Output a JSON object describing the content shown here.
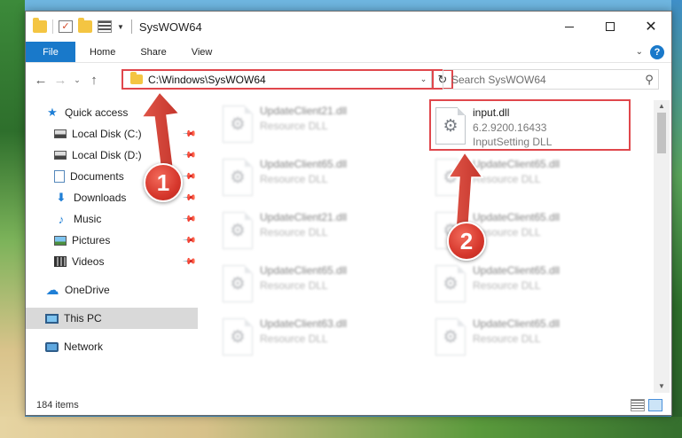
{
  "window": {
    "title": "SysWOW64"
  },
  "ribbon": {
    "tabs": [
      "File",
      "Home",
      "Share",
      "View"
    ],
    "help_label": "?"
  },
  "navigation": {
    "address_path": "C:\\Windows\\SysWOW64",
    "search_placeholder": "Search SysWOW64"
  },
  "sidebar": {
    "items": [
      {
        "label": "Quick access",
        "icon": "star-icon"
      },
      {
        "label": "Local Disk (C:)",
        "icon": "drive-icon",
        "pinned": true
      },
      {
        "label": "Local Disk (D:)",
        "icon": "drive-icon",
        "pinned": true
      },
      {
        "label": "Documents",
        "icon": "documents-icon",
        "pinned": true
      },
      {
        "label": "Downloads",
        "icon": "download-icon",
        "pinned": true
      },
      {
        "label": "Music",
        "icon": "music-icon",
        "pinned": true
      },
      {
        "label": "Pictures",
        "icon": "pictures-icon",
        "pinned": true
      },
      {
        "label": "Videos",
        "icon": "videos-icon",
        "pinned": true
      },
      {
        "label": "OneDrive",
        "icon": "cloud-icon"
      },
      {
        "label": "This PC",
        "icon": "computer-icon",
        "selected": true
      },
      {
        "label": "Network",
        "icon": "network-icon"
      }
    ]
  },
  "files": {
    "featured": {
      "name": "input.dll",
      "version": "6.2.9200.16433",
      "description": "InputSetting DLL"
    },
    "left_column": [
      {
        "name": "UpdateClient21.dll",
        "type": "Resource DLL"
      },
      {
        "name": "UpdateClient65.dll",
        "type": "Resource DLL"
      },
      {
        "name": "UpdateClient21.dll",
        "type": "Resource DLL"
      },
      {
        "name": "UpdateClient65.dll",
        "type": "Resource DLL"
      },
      {
        "name": "UpdateClient63.dll",
        "type": "Resource DLL"
      }
    ],
    "right_column": [
      {
        "name": "UpdateClient65.dll",
        "type": "Resource DLL"
      },
      {
        "name": "UpdateClient65.dll",
        "type": "Resource DLL"
      },
      {
        "name": "UpdateClient65.dll",
        "type": "Resource DLL"
      },
      {
        "name": "UpdateClient65.dll",
        "type": "Resource DLL"
      }
    ]
  },
  "status": {
    "item_count": "184 items"
  },
  "annotations": {
    "step1": "1",
    "step2": "2",
    "accent_color": "#e0474c"
  }
}
